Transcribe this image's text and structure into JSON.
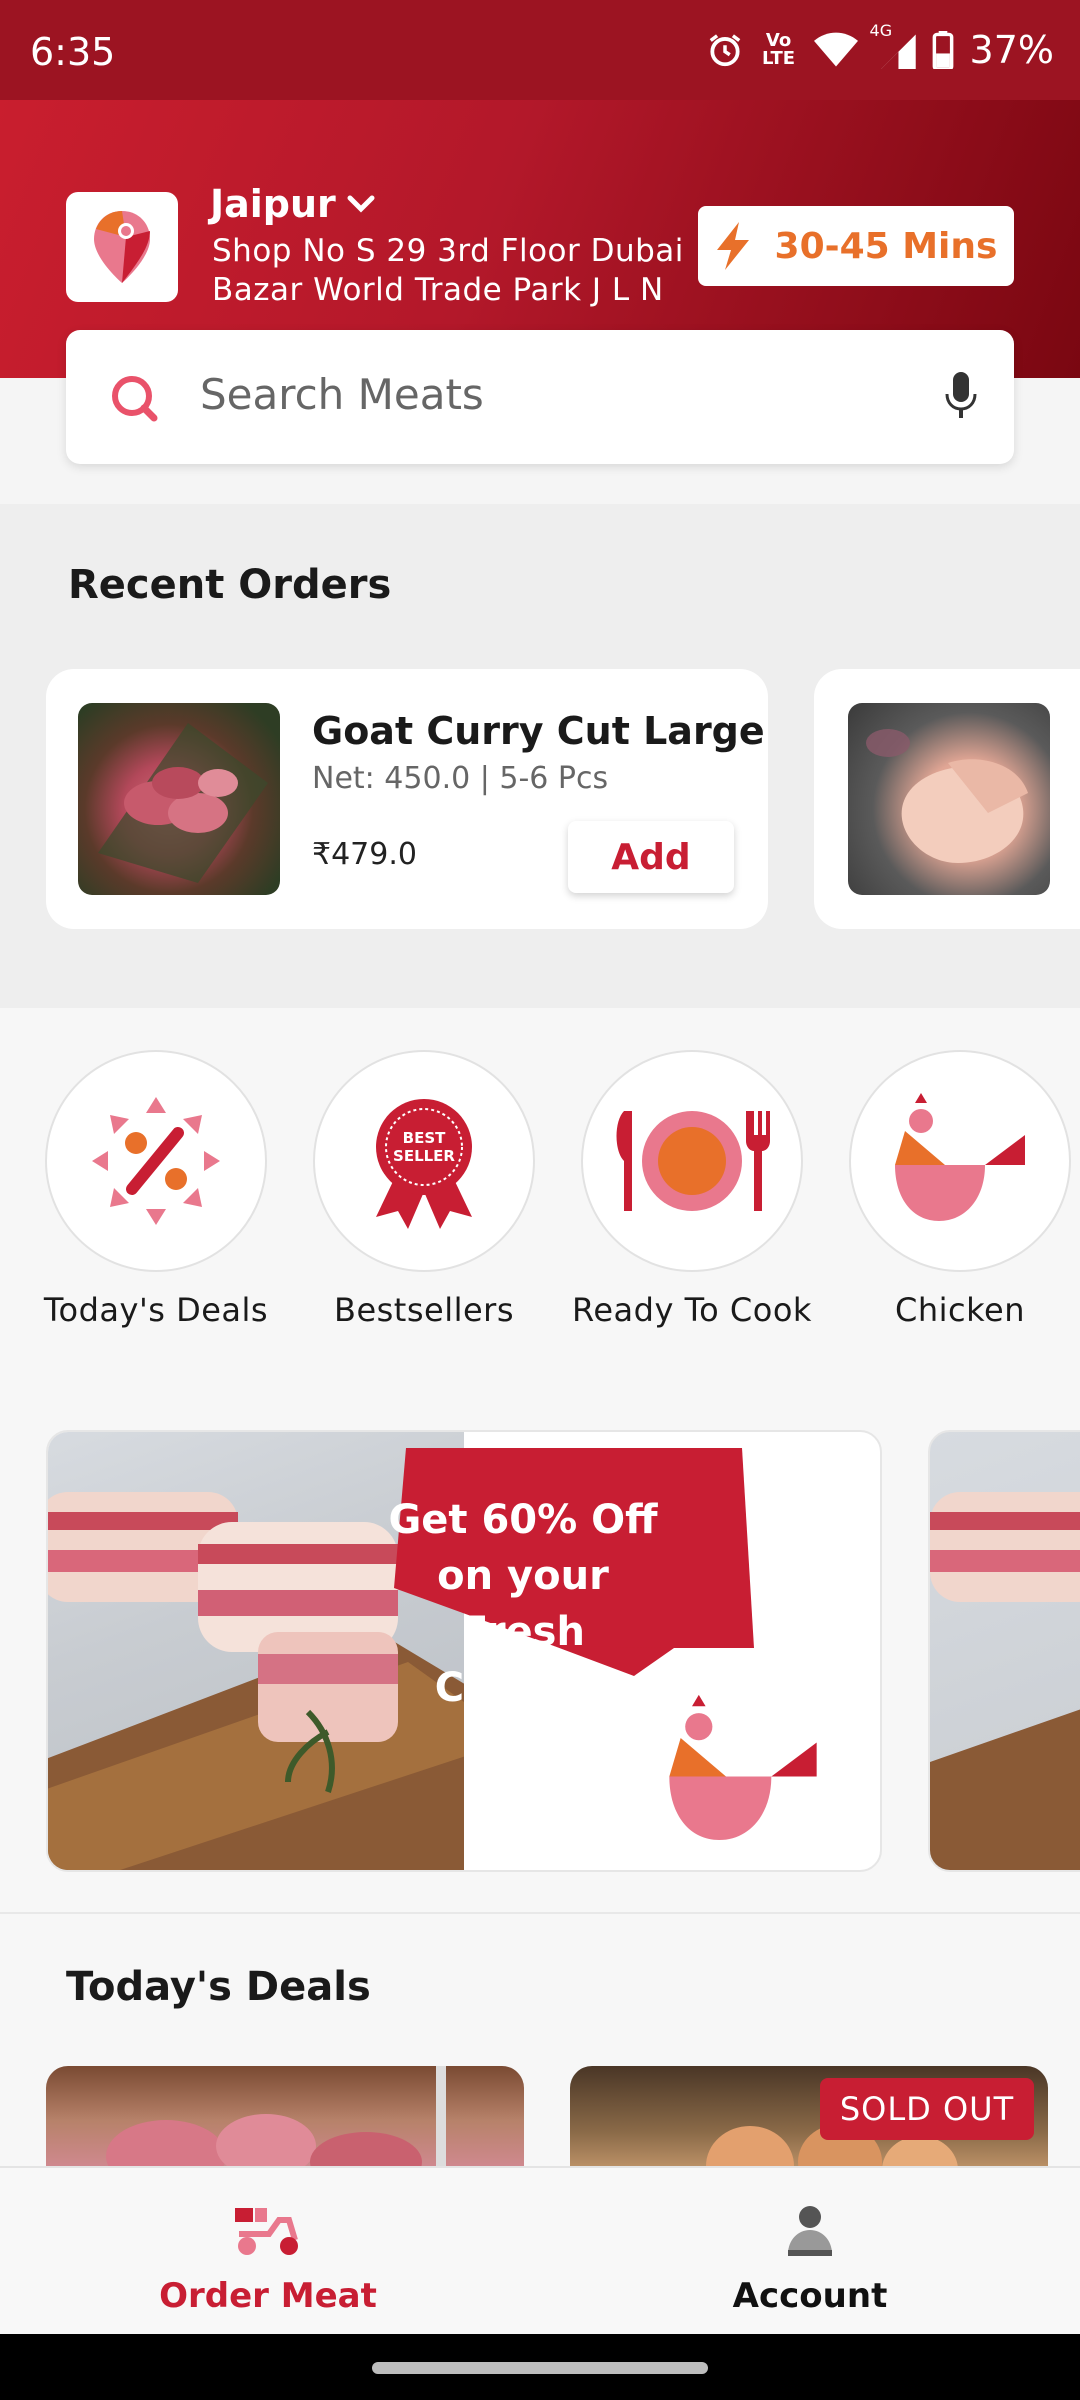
{
  "status_bar": {
    "time": "6:35",
    "network_label": "Vo LTE",
    "signal_label": "4G",
    "battery": "37%"
  },
  "header": {
    "city": "Jaipur",
    "address_line1": "Shop No S 29 3rd Floor Dubai",
    "address_line2": "Bazar World Trade Park J L N",
    "eta": "30-45 Mins"
  },
  "search": {
    "placeholder": "Search Meats"
  },
  "recent_orders": {
    "title": "Recent Orders",
    "items": [
      {
        "name": "Goat Curry Cut Large",
        "meta": "Net: 450.0 | 5-6 Pcs",
        "price": "₹479.0",
        "add_label": "Add"
      }
    ]
  },
  "categories": [
    {
      "label": "Today's Deals",
      "icon": "percent-badge-icon"
    },
    {
      "label": "Bestsellers",
      "icon": "best-seller-ribbon-icon"
    },
    {
      "label": "Ready To Cook",
      "icon": "plate-fork-knife-icon"
    },
    {
      "label": "Chicken",
      "icon": "chicken-icon"
    }
  ],
  "banner": {
    "text": "Get 60% Off on your Fresh Chicken",
    "badge_text": "BEST SELLER"
  },
  "todays_deals": {
    "title": "Today's Deals",
    "sold_out_label": "SOLD OUT"
  },
  "bottom_nav": {
    "order_meat": "Order Meat",
    "account": "Account"
  },
  "colors": {
    "brand_red": "#c81e33",
    "header_dark": "#7a0711",
    "accent_orange": "#e8702a",
    "pink": "#e9788d"
  }
}
